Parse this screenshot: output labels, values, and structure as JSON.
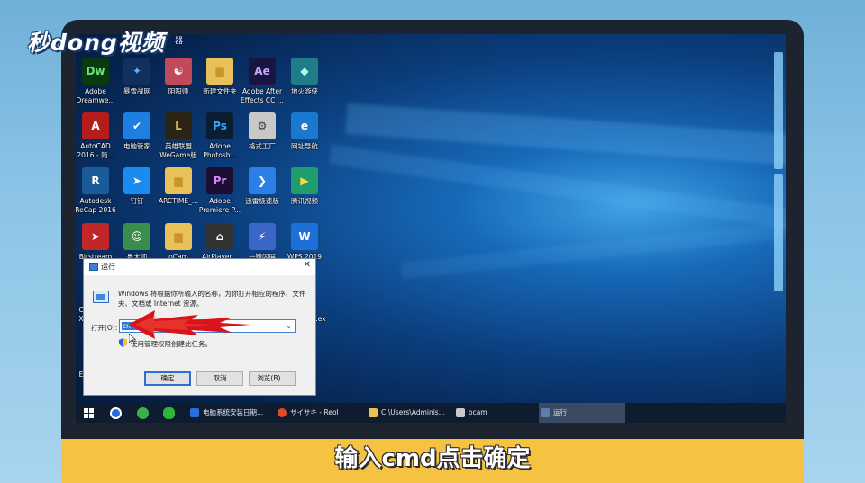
{
  "watermark": {
    "logo_text": "秒dong视频"
  },
  "desktop": {
    "top_partial_text": "器",
    "icons": [
      {
        "label": "Adobe\nDreamwe...",
        "glyph": "Dw",
        "color": "#0a3b10",
        "fg": "#6fe07a"
      },
      {
        "label": "暴雪战网",
        "glyph": "✦",
        "color": "#12305e",
        "fg": "#58b6ff"
      },
      {
        "label": "阴阳师",
        "glyph": "☯",
        "color": "#c04a5a",
        "fg": "#ffffff"
      },
      {
        "label": "新建文件夹",
        "glyph": "▆",
        "color": "#e9c15a",
        "fg": "#c9952a"
      },
      {
        "label": "Adobe After\nEffects CC ...",
        "glyph": "Ae",
        "color": "#1a1540",
        "fg": "#c4a8ff"
      },
      {
        "label": "地火游侠",
        "glyph": "◆",
        "color": "#1f7d8a",
        "fg": "#a7ffee"
      },
      {
        "label": "AutoCAD\n2016 - 简...",
        "glyph": "A",
        "color": "#b51d1d",
        "fg": "#ffffff"
      },
      {
        "label": "电脑管家",
        "glyph": "✔",
        "color": "#1e7fe0",
        "fg": "#ffffff"
      },
      {
        "label": "英雄联盟\nWeGame版",
        "glyph": "L",
        "color": "#2b2414",
        "fg": "#d9b25b"
      },
      {
        "label": "Adobe\nPhotosh...",
        "glyph": "Ps",
        "color": "#0b1d33",
        "fg": "#36a8ff"
      },
      {
        "label": "格式工厂",
        "glyph": "⚙",
        "color": "#c8c8c8",
        "fg": "#3d3d3d"
      },
      {
        "label": "网址导航",
        "glyph": "e",
        "color": "#1a79cf",
        "fg": "#ffffff"
      },
      {
        "label": "Autodesk\nReCap 2016",
        "glyph": "R",
        "color": "#1a5b9a",
        "fg": "#ffffff"
      },
      {
        "label": "钉钉",
        "glyph": "➤",
        "color": "#1a8bf0",
        "fg": "#ffffff"
      },
      {
        "label": "ARCTIME_...",
        "glyph": "▆",
        "color": "#e9c15a",
        "fg": "#c9952a"
      },
      {
        "label": "Adobe\nPremiere P...",
        "glyph": "Pr",
        "color": "#1e0d33",
        "fg": "#d18cff"
      },
      {
        "label": "迅雷极速版",
        "glyph": "❯",
        "color": "#2b7fe6",
        "fg": "#ffffff"
      },
      {
        "label": "腾讯视频",
        "glyph": "▶",
        "color": "#1f9e6b",
        "fg": "#ffd94a"
      },
      {
        "label": "Birstream\nP...",
        "glyph": "➤",
        "color": "#c12727",
        "fg": "#ffffff"
      },
      {
        "label": "鲁大师",
        "glyph": "☺",
        "color": "#3a8d4a",
        "fg": "#ffffff"
      },
      {
        "label": "oCam",
        "glyph": "▆",
        "color": "#e9c15a",
        "fg": "#c9952a"
      },
      {
        "label": "AirPlayer...",
        "glyph": "⌂",
        "color": "#333333",
        "fg": "#ffffff"
      },
      {
        "label": "一键闪屏",
        "glyph": "⚡",
        "color": "#3a66c8",
        "fg": "#ffffff"
      },
      {
        "label": "WPS 2019",
        "glyph": "W",
        "color": "#1f6fd8",
        "fg": "#ffffff"
      }
    ],
    "side_fragments": [
      "C",
      "X",
      "E"
    ],
    "right_fragment": ".ex"
  },
  "run_dialog": {
    "title": "运行",
    "close_glyph": "✕",
    "description": "Windows 将根据你所输入的名称，为你打开相应的程序、文件夹、文档或 Internet 资源。",
    "open_label": "打开(O):",
    "input_value": "cmd",
    "dropdown_glyph": "⌄",
    "admin_note": "使用管理权限创建此任务。",
    "buttons": {
      "ok": "确定",
      "cancel": "取消",
      "browse": "浏览(B)..."
    }
  },
  "taskbar": {
    "items": [
      {
        "label": "电脑系统安装日期...",
        "icon_color": "#2a6de0"
      },
      {
        "label": "サイサキ - Reol",
        "icon_color": "#e04a2a"
      },
      {
        "label": "C:\\Users\\Adminis...",
        "icon_color": "#e9c15a"
      },
      {
        "label": "ocam",
        "icon_color": "#c9c9c9"
      },
      {
        "label": "运行",
        "icon_color": "#5a7fb0"
      }
    ]
  },
  "caption": {
    "text": "输入cmd点击确定"
  },
  "colors": {
    "accent_blue": "#2f78d6",
    "caption_bar": "#f5c242",
    "arrow_red": "#d8141a"
  }
}
